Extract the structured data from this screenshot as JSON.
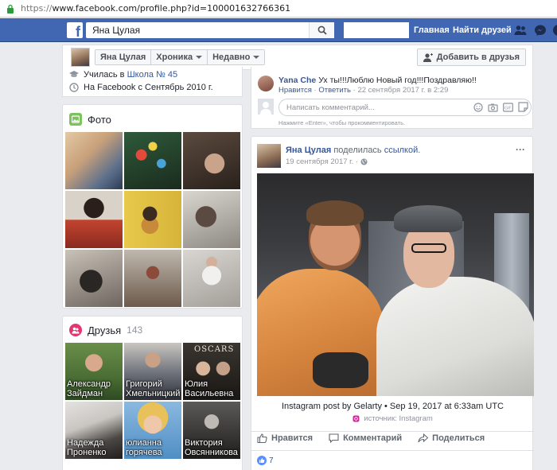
{
  "browser": {
    "scheme": "https://",
    "url_rest": "www.facebook.com/profile.php?id=100001632766361"
  },
  "topbar": {
    "logo": "f",
    "search_value": "Яна Цулая",
    "nav_home": "Главная",
    "nav_find_friends": "Найти друзей"
  },
  "profile_nav": {
    "name": "Яна Цулая",
    "tab_timeline": "Хроника",
    "tab_recent": "Недавно",
    "add_friend": "Добавить в друзья"
  },
  "intro": {
    "studied_prefix": "Училась в",
    "school": "Школа № 45",
    "on_facebook": "На Facebook с Сентябрь 2010 г."
  },
  "photos": {
    "title": "Фото"
  },
  "friends": {
    "title": "Друзья",
    "count": "143",
    "items": [
      {
        "name": "Александр Зайдман"
      },
      {
        "name": "Григорий Хмельницкий"
      },
      {
        "name": "Юлия Васильевна"
      },
      {
        "name": "Надежда Проненко"
      },
      {
        "name": "юлианна горячева"
      },
      {
        "name": "Виктория Овсянникова"
      }
    ],
    "tile_text_oscars": "OSCARS"
  },
  "comment": {
    "author": "Yana Che",
    "text": " Ух ты!!!Люблю Новый год!!!Поздравляю!!",
    "like": "Нравится",
    "reply": "Ответить",
    "date": "22 сентября 2017 г. в 2:29",
    "input_placeholder": "Написать комментарий...",
    "hint": "Нажмите «Enter», чтобы прокомментировать."
  },
  "post": {
    "author": "Яна Цулая",
    "action": "поделилась",
    "link_word": "ссылкой",
    "period": ".",
    "date": "19 сентября 2017 г. ·",
    "more": "···",
    "caption": "Instagram post by Gelarty • Sep 19, 2017 at 6:33am UTC",
    "source": "источник: Instagram",
    "like_action": "Нравится",
    "comment_action": "Комментарий",
    "share_action": "Поделиться",
    "reactions_count": "7"
  },
  "colors": {
    "fb_blue": "#4267b2",
    "link": "#365899",
    "background": "#e9ebee"
  }
}
